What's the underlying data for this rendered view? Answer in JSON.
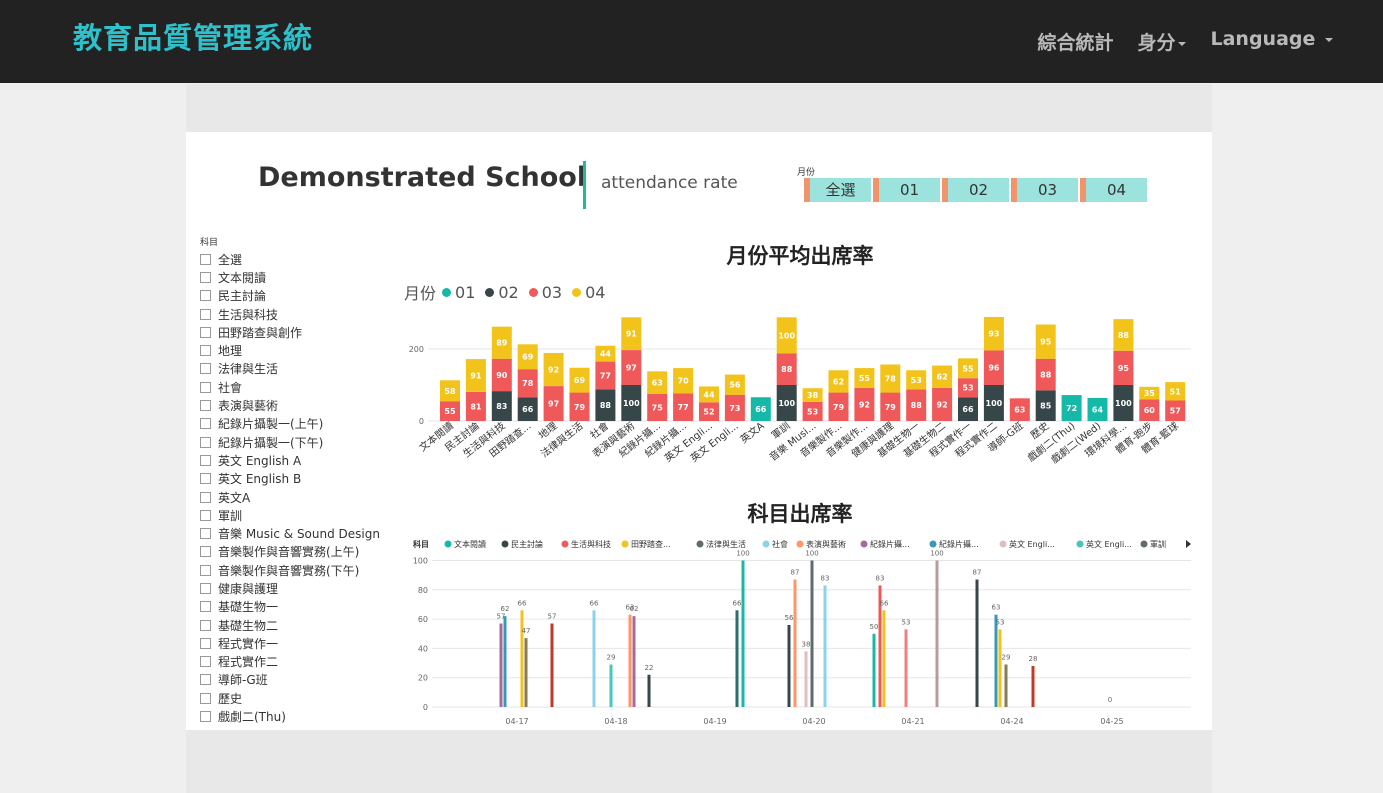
{
  "navbar": {
    "brand": "教育品質管理系統",
    "stats": "綜合統計",
    "identity": "身分",
    "language": "Language"
  },
  "header": {
    "school": "Demonstrated School",
    "subtitle": "attendance rate",
    "month_label": "月份",
    "months": [
      "全選",
      "01",
      "02",
      "03",
      "04"
    ]
  },
  "subjects": {
    "label": "科目",
    "items": [
      "全選",
      "文本閱讀",
      "民主討論",
      "生活與科技",
      "田野踏查與創作",
      "地理",
      "法律與生活",
      "社會",
      "表演與藝術",
      "紀錄片攝製一(上午)",
      "紀錄片攝製一(下午)",
      "英文 English A",
      "英文 English B",
      "英文A",
      "軍訓",
      "音樂 Music & Sound Design",
      "音樂製作與音響實務(上午)",
      "音樂製作與音響實務(下午)",
      "健康與護理",
      "基礎生物一",
      "基礎生物二",
      "程式實作一",
      "程式實作二",
      "導師-G班",
      "歷史",
      "戲劇二(Thu)"
    ]
  },
  "colors": {
    "m01": "#16b8a8",
    "m02": "#374649",
    "m03": "#f0595a",
    "m04": "#f2c31a"
  },
  "chart_data": [
    {
      "type": "bar",
      "title": "月份平均出席率",
      "legend_title": "月份",
      "series_names": [
        "01",
        "02",
        "03",
        "04"
      ],
      "ylim": [
        0,
        300
      ],
      "yticks": [
        0,
        200
      ],
      "categories": [
        "文本閱讀",
        "民主討論",
        "生活與科技",
        "田野踏查...",
        "地理",
        "法律與生活",
        "社會",
        "表演與藝術",
        "紀錄片攝...",
        "紀錄片攝...",
        "英文 Engli...",
        "英文 Engli...",
        "英文A",
        "軍訓",
        "音樂 Musi...",
        "音樂製作...",
        "音樂製作...",
        "健康與護理",
        "基礎生物一",
        "基礎生物二",
        "程式實作一",
        "程式實作二",
        "導師-G班",
        "歷史",
        "戲劇二(Thu)",
        "戲劇二(Wed)",
        "環境科學...",
        "體育-跑步",
        "體育-籃球"
      ],
      "stacks": [
        [
          [
            3,
            55
          ],
          [
            4,
            58
          ]
        ],
        [
          [
            3,
            81
          ],
          [
            4,
            91
          ]
        ],
        [
          [
            2,
            83
          ],
          [
            3,
            90
          ],
          [
            4,
            89
          ]
        ],
        [
          [
            2,
            66
          ],
          [
            3,
            78
          ],
          [
            4,
            69
          ]
        ],
        [
          [
            3,
            97
          ],
          [
            4,
            92
          ]
        ],
        [
          [
            3,
            79
          ],
          [
            4,
            69
          ]
        ],
        [
          [
            2,
            88
          ],
          [
            3,
            77
          ],
          [
            4,
            44
          ]
        ],
        [
          [
            2,
            100
          ],
          [
            3,
            97
          ],
          [
            4,
            91
          ]
        ],
        [
          [
            3,
            75
          ],
          [
            4,
            63
          ]
        ],
        [
          [
            3,
            77
          ],
          [
            4,
            70
          ]
        ],
        [
          [
            3,
            52
          ],
          [
            4,
            44
          ]
        ],
        [
          [
            3,
            73
          ],
          [
            4,
            56
          ]
        ],
        [
          [
            1,
            66
          ]
        ],
        [
          [
            2,
            100
          ],
          [
            3,
            88
          ],
          [
            4,
            100
          ]
        ],
        [
          [
            3,
            53
          ],
          [
            4,
            38
          ]
        ],
        [
          [
            3,
            79
          ],
          [
            4,
            62
          ]
        ],
        [
          [
            3,
            92
          ],
          [
            4,
            55
          ]
        ],
        [
          [
            3,
            79
          ],
          [
            4,
            78
          ]
        ],
        [
          [
            3,
            88
          ],
          [
            4,
            53
          ]
        ],
        [
          [
            3,
            92
          ],
          [
            4,
            62
          ]
        ],
        [
          [
            2,
            66
          ],
          [
            3,
            53
          ],
          [
            4,
            55
          ]
        ],
        [
          [
            2,
            100
          ],
          [
            3,
            96
          ],
          [
            4,
            93
          ]
        ],
        [
          [
            3,
            63
          ]
        ],
        [
          [
            2,
            85
          ],
          [
            3,
            88
          ],
          [
            4,
            95
          ]
        ],
        [
          [
            1,
            72
          ]
        ],
        [
          [
            1,
            64
          ]
        ],
        [
          [
            2,
            100
          ],
          [
            3,
            95
          ],
          [
            4,
            88
          ]
        ],
        [
          [
            3,
            60
          ],
          [
            4,
            35
          ]
        ],
        [
          [
            3,
            57
          ],
          [
            4,
            51
          ]
        ]
      ]
    },
    {
      "type": "bar",
      "title": "科目出席率",
      "legend_title": "科目",
      "legend": [
        {
          "name": "文本閱讀",
          "color": "#16b8a8"
        },
        {
          "name": "民主討論",
          "color": "#374649"
        },
        {
          "name": "生活與科技",
          "color": "#f0595a"
        },
        {
          "name": "田野踏查...",
          "color": "#f2c31a"
        },
        {
          "name": "法律與生活",
          "color": "#5f6b6d"
        },
        {
          "name": "社會",
          "color": "#8ad4eb"
        },
        {
          "name": "表演與藝術",
          "color": "#fe9666"
        },
        {
          "name": "紀錄片攝...",
          "color": "#a66999"
        },
        {
          "name": "紀錄片攝...",
          "color": "#3599b8"
        },
        {
          "name": "英文 Engli...",
          "color": "#dfbfbf"
        },
        {
          "name": "英文 Engli...",
          "color": "#4ac5bb"
        },
        {
          "name": "軍訓",
          "color": "#5f6b6d"
        }
      ],
      "ylim": [
        0,
        100
      ],
      "yticks": [
        0,
        20,
        40,
        60,
        80,
        100
      ],
      "categories": [
        "04-17",
        "04-18",
        "04-19",
        "04-20",
        "04-21",
        "04-24",
        "04-25"
      ],
      "bars": [
        {
          "date": "04-17",
          "value": 57,
          "color": "#a66999"
        },
        {
          "date": "04-17",
          "value": 62,
          "color": "#3599b8"
        },
        {
          "date": "04-17",
          "value": 66,
          "color": "#f2c31a"
        },
        {
          "date": "04-17",
          "value": 47,
          "color": "#8a7a55"
        },
        {
          "date": "04-17",
          "value": 57,
          "color": "#c0392b"
        },
        {
          "date": "04-18",
          "value": 66,
          "color": "#8ad4eb"
        },
        {
          "date": "04-18",
          "value": 29,
          "color": "#4ac5bb"
        },
        {
          "date": "04-18",
          "value": 63,
          "color": "#fe9666"
        },
        {
          "date": "04-18",
          "value": 62,
          "color": "#a66999"
        },
        {
          "date": "04-18",
          "value": 22,
          "color": "#374649"
        },
        {
          "date": "04-19",
          "value": 66,
          "color": "#2a6e6e"
        },
        {
          "date": "04-19",
          "value": 100,
          "color": "#16b8a8"
        },
        {
          "date": "04-20",
          "value": 56,
          "color": "#374649"
        },
        {
          "date": "04-20",
          "value": 87,
          "color": "#fe9666"
        },
        {
          "date": "04-20",
          "value": 38,
          "color": "#dfbfbf"
        },
        {
          "date": "04-20",
          "value": 100,
          "color": "#5f6b6d"
        },
        {
          "date": "04-20",
          "value": 83,
          "color": "#8ad4eb"
        },
        {
          "date": "04-21",
          "value": 50,
          "color": "#16b8a8"
        },
        {
          "date": "04-21",
          "value": 83,
          "color": "#f0595a"
        },
        {
          "date": "04-21",
          "value": 66,
          "color": "#f2c31a"
        },
        {
          "date": "04-21",
          "value": 53,
          "color": "#f08080"
        },
        {
          "date": "04-21",
          "value": 100,
          "color": "#b89c9c"
        },
        {
          "date": "04-24",
          "value": 87,
          "color": "#374649"
        },
        {
          "date": "04-24",
          "value": 63,
          "color": "#3599b8"
        },
        {
          "date": "04-24",
          "value": 53,
          "color": "#f2c31a"
        },
        {
          "date": "04-24",
          "value": 29,
          "color": "#8a7a55"
        },
        {
          "date": "04-24",
          "value": 28,
          "color": "#c0392b"
        },
        {
          "date": "04-25",
          "value": 0,
          "color": "#374649"
        }
      ]
    }
  ]
}
